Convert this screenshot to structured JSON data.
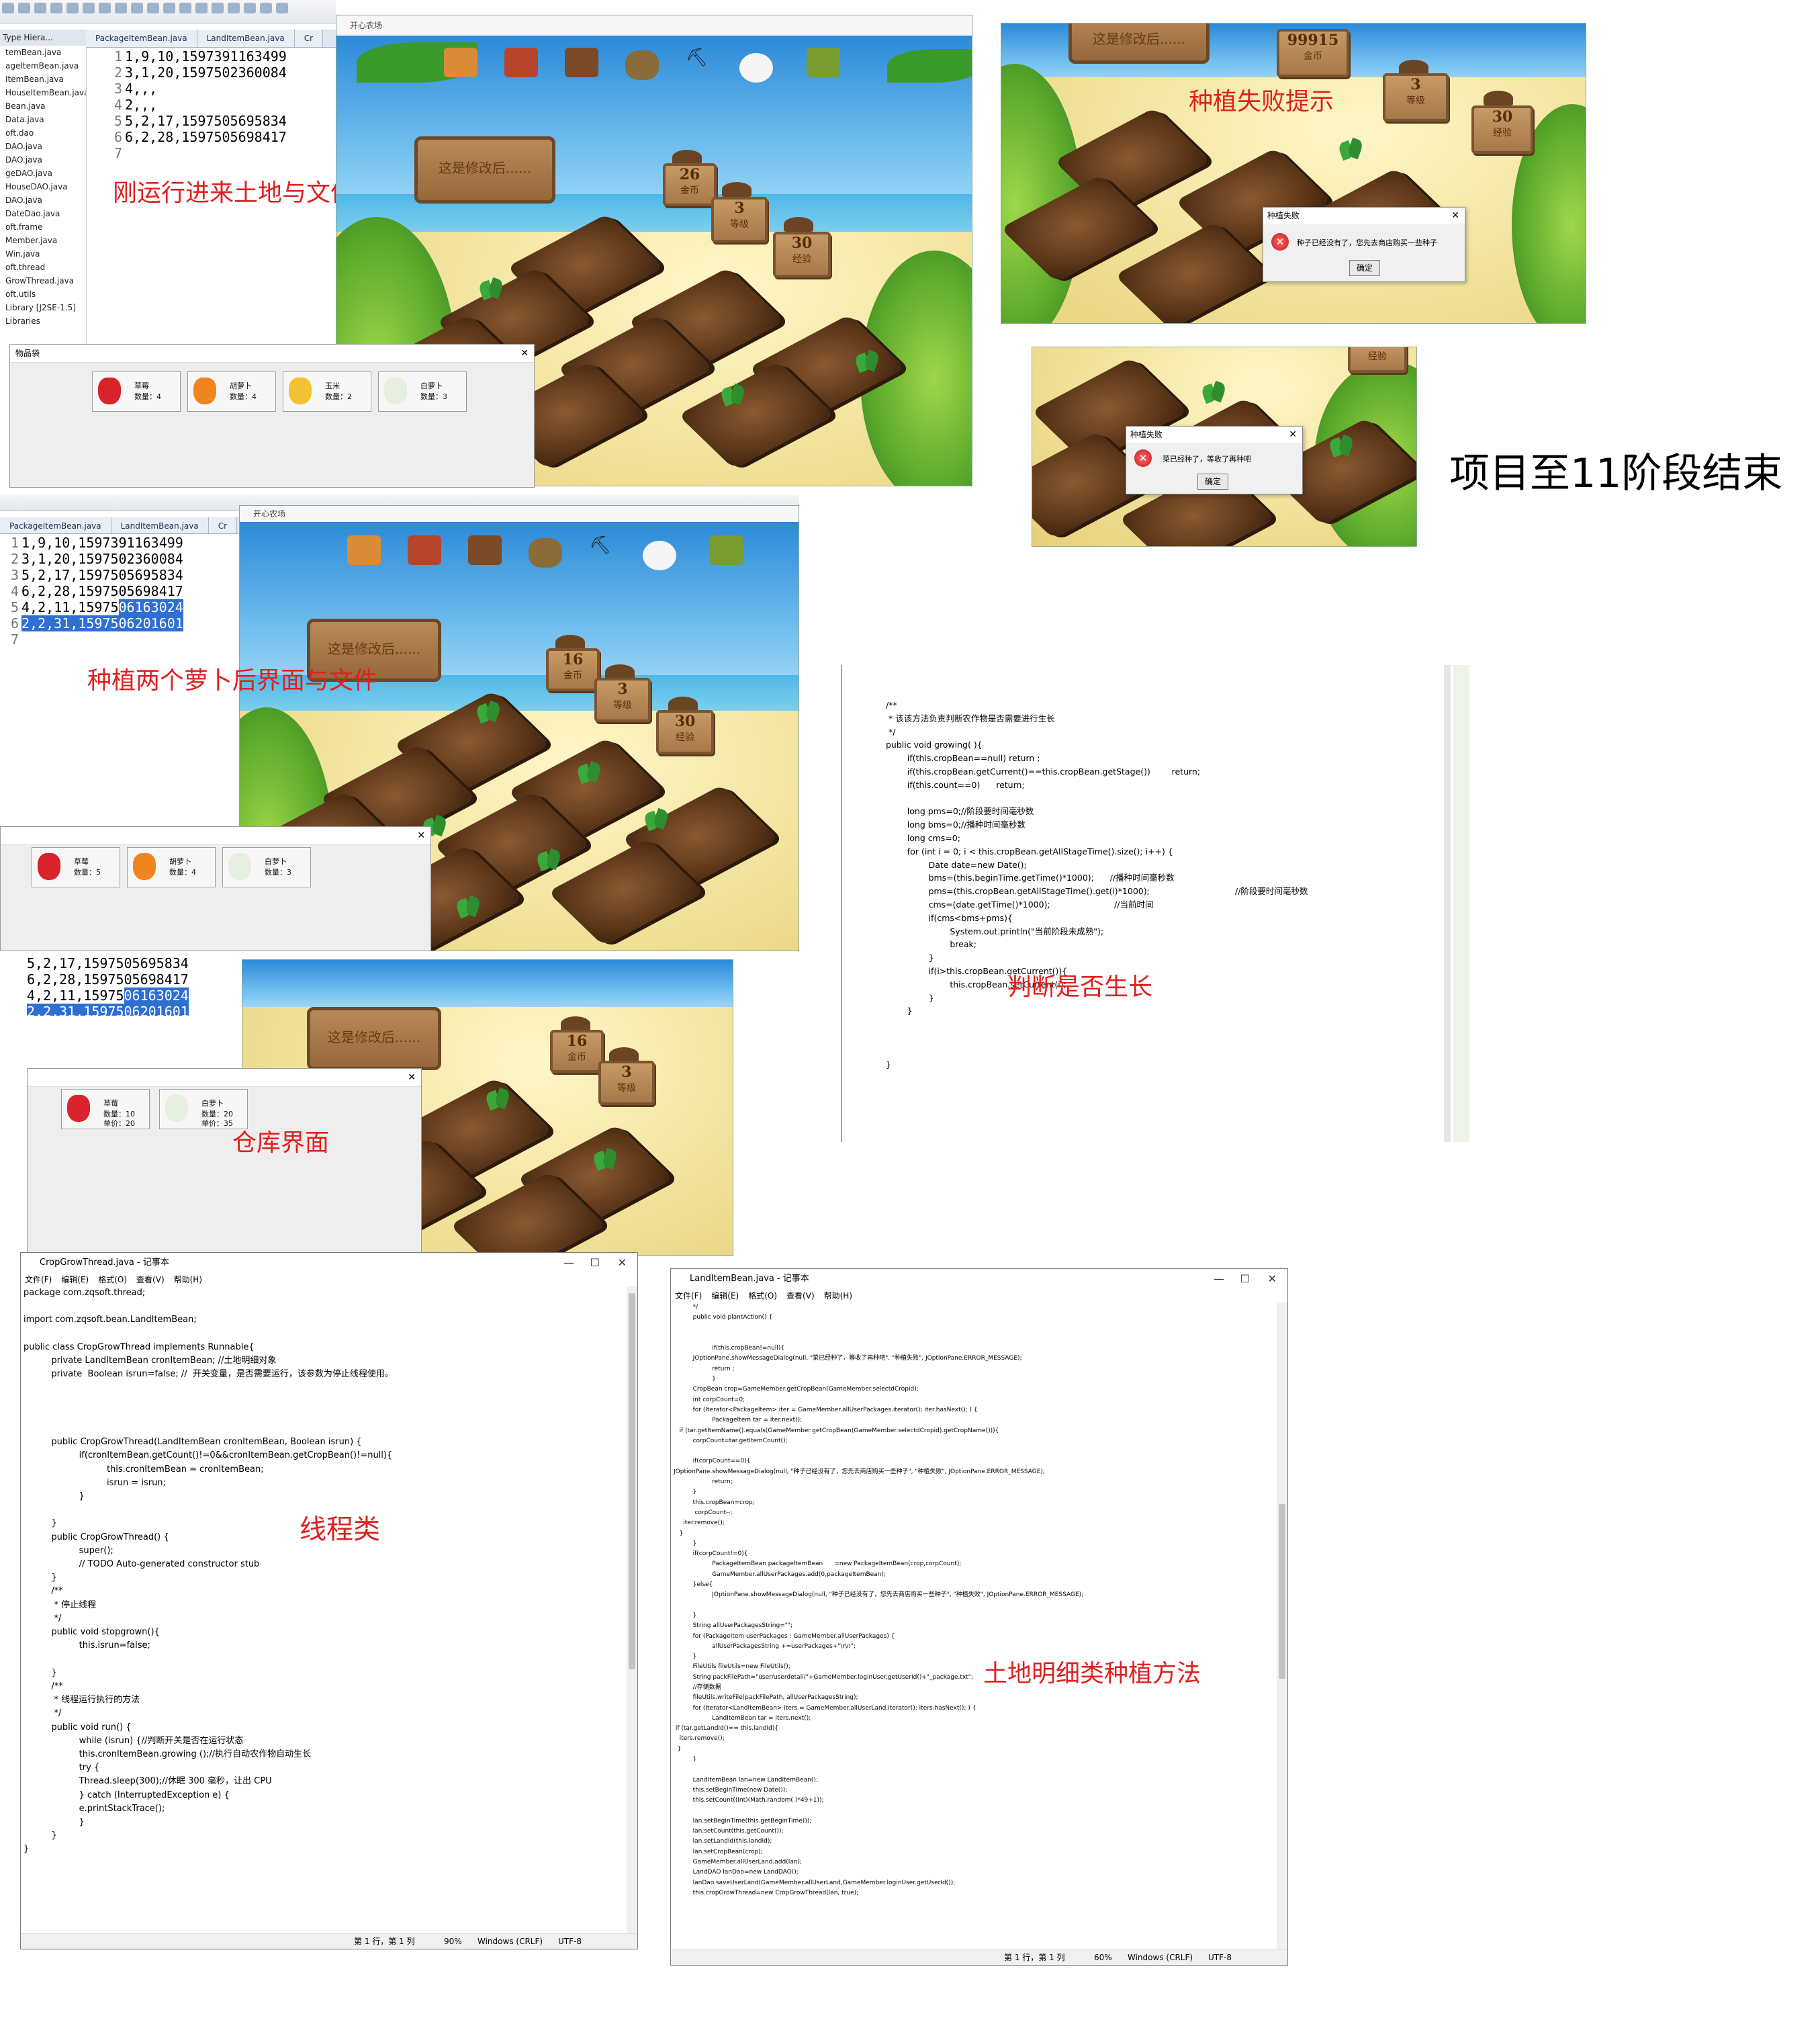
{
  "captions": {
    "initial_land_file": "刚运行进来土地与文件",
    "plant_fail_hint": "种植失败提示",
    "project_end": "项目至11阶段结束",
    "after_plant_two": "种植两个萝卜后界面与文件",
    "judge_growth": "判断是否生长",
    "warehouse": "仓库界面",
    "thread_class": "线程类",
    "land_plant_method": "土地明细类种植方法"
  },
  "colors": {
    "caption_red": "#e02020",
    "selection_blue": "#2f6fd1"
  },
  "eclipse_top": {
    "tree_title": "Type Hiera...",
    "tabs": [
      "PackageItemBean.java",
      "LandItemBean.java",
      "Cr"
    ],
    "tree_items": [
      "temBean.java",
      "ageItemBean.java",
      "ItemBean.java",
      "HouseItemBean.java",
      "Bean.java",
      "Data.java",
      "oft.dao",
      "DAO.java",
      "DAO.java",
      "geDAO.java",
      "HouseDAO.java",
      "DAO.java",
      "DateDao.java",
      "oft.frame",
      "Member.java",
      "Win.java",
      "oft.thread",
      "GrowThread.java",
      "oft.utils",
      "Library [J2SE-1.5]",
      "Libraries"
    ],
    "code_lines": [
      "1,9,10,1597391163499",
      "3,1,20,1597502360084",
      "4,,,",
      "2,,,",
      "5,2,17,1597505695834",
      "6,2,28,1597505698417",
      ""
    ]
  },
  "eclipse_mid": {
    "tabs": [
      "PackageItemBean.java",
      "LandItemBean.java",
      "Cr"
    ],
    "code_lines": [
      {
        "plain": "1,9,10,1597391163499",
        "sel": ""
      },
      {
        "plain": "3,1,20,1597502360084",
        "sel": ""
      },
      {
        "plain": "5,2,17,1597505695834",
        "sel": ""
      },
      {
        "plain": "6,2,28,1597505698417",
        "sel": ""
      },
      {
        "plain": "4,2,11,15975",
        "sel": "06163024"
      },
      {
        "plain": "",
        "sel": "2,2,31,1597506201601"
      },
      {
        "plain": "",
        "sel": ""
      }
    ]
  },
  "eclipse_low": {
    "code_lines": [
      {
        "plain": "5,2,17,1597505695834",
        "sel": ""
      },
      {
        "plain": "6,2,28,1597505698417",
        "sel": ""
      },
      {
        "plain": "4,2,11,15975",
        "sel": "06163024"
      },
      {
        "plain": "",
        "sel": "2,2,31,1597506201601"
      }
    ]
  },
  "game": {
    "window_title": "开心农场",
    "board_text": "这是修改后......",
    "top": {
      "gold": "26",
      "gold_label": "金币",
      "level": "3",
      "level_label": "等级",
      "exp": "30",
      "exp_label": "经验"
    },
    "mid": {
      "gold": "16",
      "gold_label": "金币",
      "level": "3",
      "level_label": "等级",
      "exp": "30",
      "exp_label": "经验"
    },
    "low": {
      "gold": "16",
      "gold_label": "金币",
      "level": "3",
      "level_label": "等级"
    },
    "fail": {
      "gold": "99915",
      "gold_label": "金币",
      "level": "3",
      "level_label": "等级",
      "exp": "30",
      "exp_label": "经验"
    },
    "small_sign": "经验"
  },
  "dialogs": {
    "no_seed": {
      "title": "种植失败",
      "message": "种子已经没有了，您先去商店购买一些种子",
      "ok": "确定"
    },
    "already_planted": {
      "title": "种植失败",
      "message": "菜已经种了，等收了再种吧",
      "ok": "确定"
    }
  },
  "bag_top": {
    "title": "物品袋",
    "items": [
      {
        "name": "草莓",
        "qty": "数量：4",
        "icon": "strawberry-icon",
        "color": "#d8232a"
      },
      {
        "name": "胡萝卜",
        "qty": "数量：4",
        "icon": "carrot-icon",
        "color": "#f0841e"
      },
      {
        "name": "玉米",
        "qty": "数量：2",
        "icon": "corn-icon",
        "color": "#f2c233"
      },
      {
        "name": "白萝卜",
        "qty": "数量：3",
        "icon": "radish-icon",
        "color": "#e6efe0"
      }
    ]
  },
  "bag_mid": {
    "items": [
      {
        "name": "草莓",
        "qty": "数量：5",
        "icon": "strawberry-icon",
        "color": "#d8232a"
      },
      {
        "name": "胡萝卜",
        "qty": "数量：4",
        "icon": "carrot-icon",
        "color": "#f0841e"
      },
      {
        "name": "白萝卜",
        "qty": "数量：3",
        "icon": "radish-icon",
        "color": "#e6efe0"
      }
    ]
  },
  "warehouse": {
    "items": [
      {
        "name": "草莓",
        "qty": "数量：10",
        "unit": "单价：20",
        "icon": "strawberry-icon",
        "color": "#d8232a"
      },
      {
        "name": "白萝卜",
        "qty": "数量：20",
        "unit": "单价：35",
        "icon": "radish-icon",
        "color": "#e6efe0"
      }
    ]
  },
  "growing_code": "/**\n * 该该方法负责判断农作物是否需要进行生长\n */\npublic void growing( ){\n        if(this.cropBean==null) return ;\n        if(this.cropBean.getCurrent()==this.cropBean.getStage())        return;\n        if(this.count==0)      return;\n\n        long pms=0;//阶段要时间毫秒数\n        long bms=0;//播种时间毫秒数\n        long cms=0;\n        for (int i = 0; i < this.cropBean.getAllStageTime().size(); i++) {\n                Date date=new Date();\n                bms=(this.beginTime.getTime()*1000);      //播种时间毫秒数\n                pms=(this.cropBean.getAllStageTime().get(i)*1000);                                //阶段要时间毫秒数\n                cms=(date.getTime()*1000);                        //当前时间\n                if(cms<bms+pms){\n                        System.out.println(\"当前阶段未成熟\");\n                        break;\n                }\n                if(i>this.cropBean.getCurrent()){\n                        this.cropBean.setCurrent(i);\n                }\n        }\n\n\n\n}",
  "notepad_thread": {
    "title": "CropGrowThread.java - 记事本",
    "menu": [
      "文件(F)",
      "编辑(E)",
      "格式(O)",
      "查看(V)",
      "帮助(H)"
    ],
    "status": {
      "pos": "第 1 行，第 1 列",
      "zoom": "90%",
      "eol": "Windows (CRLF)",
      "enc": "UTF-8"
    },
    "body": "package com.zqsoft.thread;\n\nimport com.zqsoft.bean.LandItemBean;\n\npublic class CropGrowThread implements Runnable{\n          private LandItemBean cronItemBean; //土地明细对象\n          private  Boolean isrun=false; //  开关变量，是否需要运行，该参数为停止线程使用。\n\n\n\n\n          public CropGrowThread(LandItemBean cronItemBean, Boolean isrun) {\n                    if(cronItemBean.getCount()!=0&&cronItemBean.getCropBean()!=null){\n                              this.cronItemBean = cronItemBean;\n                              isrun = isrun;\n                    }\n\n          }\n          public CropGrowThread() {\n                    super();\n                    // TODO Auto-generated constructor stub\n          }\n          /**\n           * 停止线程\n           */\n          public void stopgrown(){\n                    this.isrun=false;\n\n          }\n          /**\n           * 线程运行执行的方法\n           */\n          public void run() {\n                    while (isrun) {//判断开关是否在运行状态\n                    this.cronItemBean.growing ();//执行自动农作物自动生长\n                    try {\n                    Thread.sleep(300);//休眠 300 毫秒，让出 CPU\n                    } catch (InterruptedException e) {\n                    e.printStackTrace();\n                    }\n          }\n}"
  },
  "notepad_land": {
    "title": "LandItemBean.java - 记事本",
    "menu": [
      "文件(F)",
      "编辑(E)",
      "格式(O)",
      "查看(V)",
      "帮助(H)"
    ],
    "status": {
      "pos": "第 1 行，第 1 列",
      "zoom": "60%",
      "eol": "Windows (CRLF)",
      "enc": "UTF-8"
    },
    "body": "          */\n          public void plantAction() {\n\n\n                    if(this.cropBean!=null){\n          JOptionPane.showMessageDialog(null, \"菜已经种了，等收了再种吧\", \"种植失败\", JOptionPane.ERROR_MESSAGE);\n                    return ;\n                    }\n          CropBean crop=GameMember.getCropBean(GameMember.selectdCropid);\n          int corpCount=0;\n          for (Iterator<PackageItem> iter = GameMember.allUserPackages.iterator(); iter.hasNext(); ) {\n                    PackageItem tar = iter.next();\n   if (tar.getItemName().equals(GameMember.getCropBean(GameMember.selectdCropid).getCropName())){\n          corpCount=tar.getItemCount();\n\n          if(corpCount==0){\nJOptionPane.showMessageDialog(null, \"种子已经没有了，您先去商店购买一些种子\", \"种植失败\", JOptionPane.ERROR_MESSAGE);\n                    return;\n          }\n          this.cropBean=crop;\n           corpCount--;\n     iter.remove();\n   }\n          }\n          if(corpCount!=0){\n                    PackageItemBean packageItemBean      =new PackageItemBean(crop,corpCount);\n                    GameMember.allUserPackages.add(0,packageItemBean);\n          }else{\n                    JOptionPane.showMessageDialog(null, \"种子已经没有了，您先去商店购买一些种子\", \"种植失败\", JOptionPane.ERROR_MESSAGE);\n\n          }\n          String allUserPackagesString=\"\";\n          for (PackageItem userPackages : GameMember.allUserPackages) {\n                    allUserPackagesString +=userPackages+\"\\r\\n\";\n          }\n          FileUtils fileUtils=new FileUtils();\n          String packFilePath=\"user/userdetail/\"+GameMember.loginUser.getUserId()+\"_package.txt\";\n          //存储数据\n          fileUtils.writeFile(packFilePath, allUserPackagesString);\n          for (Iterator<LandItemBean> iters = GameMember.allUserLand.iterator(); iters.hasNext(); ) {\n                    LandItemBean tar = iters.next();\n if (tar.getLandId()== this.landId){\n   iters.remove();\n  }\n          }\n\n          LandItemBean lan=new LandItemBean();\n          this.setBeginTime(new Date());\n          this.setCount((int)(Math.random( )*49+1));\n\n          lan.setBeginTime(this.getBeginTime());\n          lan.setCount(this.getCount());\n          lan.setLandId(this.landId);\n          lan.setCropBean(crop);\n          GameMember.allUserLand.add(lan);\n          LandDAO lanDao=new LandDAO();\n          lanDao.saveUserLand(GameMember.allUserLand,GameMember.loginUser.getUserId());\n          this.cropGrowThread=new CropGrowThread(lan, true);"
  }
}
